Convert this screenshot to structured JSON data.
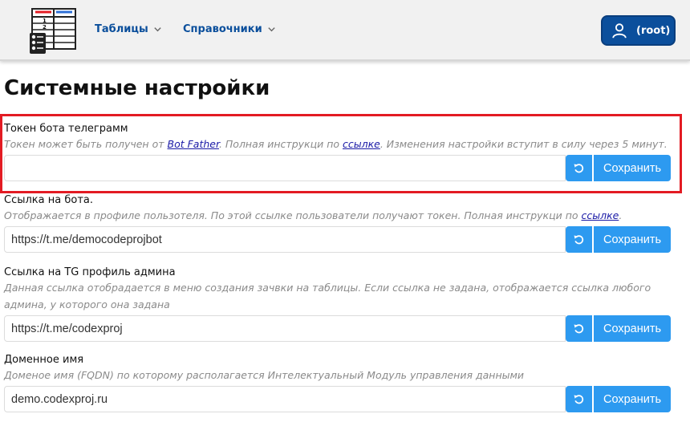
{
  "nav": {
    "items": [
      {
        "label": "Таблицы"
      },
      {
        "label": "Справочники"
      }
    ],
    "user_label": "(root)"
  },
  "page": {
    "title": "Системные настройки"
  },
  "settings": [
    {
      "label": "Токен бота телеграмм",
      "hint_before": "Токен может быть получен от ",
      "link1": "Bot Father",
      "hint_mid": ". Полная инструкци по ",
      "link2": "ссылке",
      "hint_after": ". Изменения настройки вступит в силу через 5 минут.",
      "value": ""
    },
    {
      "label": "Ссылка на бота.",
      "hint_before": "Отображается в профиле пользотеля. По этой ссылке пользователи получают токен. Полная инструкци по ",
      "link1": "ссылке",
      "hint_after": ".",
      "value": "https://t.me/democodeprojbot"
    },
    {
      "label": "Ссылка на TG профиль админа",
      "hint": "Данная ссылка отобрадается в меню создания зачвки на таблицы. Если ссылка не задана, отображается ссылка любого админа, у которого она задана",
      "value": "https://t.me/codexproj"
    },
    {
      "label": "Доменное имя",
      "hint": "Доменое имя (FQDN) по которому располагается Интелектуальный Модуль управления данными",
      "value": "demo.codexproj.ru"
    }
  ],
  "buttons": {
    "save_label": "Сохранить"
  },
  "colors": {
    "brand": "#0b4f9c",
    "button": "#2d9af0",
    "highlight": "#e31b23"
  }
}
